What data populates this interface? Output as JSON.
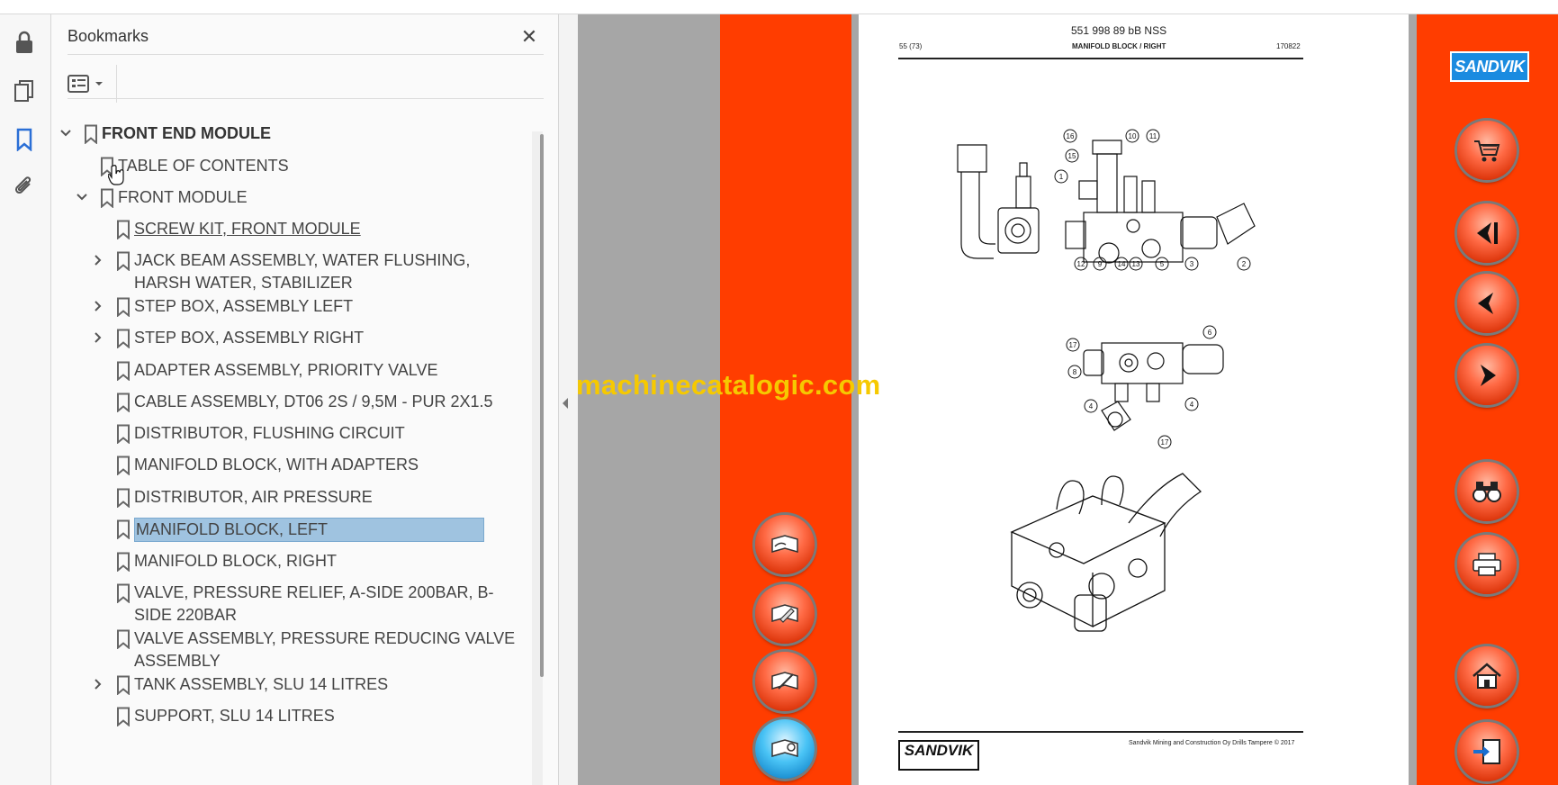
{
  "panel": {
    "title": "Bookmarks",
    "close_glyph": "✕",
    "options_icon": "bookmark-options-icon"
  },
  "left_rail": {
    "icons": [
      "lock-icon",
      "pages-icon",
      "bookmark-icon",
      "paperclip-icon"
    ]
  },
  "bookmarks": [
    {
      "label": "FRONT END MODULE",
      "level": 0,
      "expander": "expanded",
      "bold": true
    },
    {
      "label": "TABLE OF CONTENTS",
      "level": 1,
      "expander": "none"
    },
    {
      "label": "FRONT MODULE",
      "level": 1,
      "expander": "expanded"
    },
    {
      "label": "SCREW KIT, FRONT MODULE",
      "level": 2,
      "expander": "none",
      "underline": true
    },
    {
      "label": "JACK BEAM ASSEMBLY, WATER FLUSHING, HARSH WATER, STABILIZER",
      "level": 2,
      "expander": "collapsed"
    },
    {
      "label": "STEP BOX, ASSEMBLY LEFT",
      "level": 2,
      "expander": "collapsed"
    },
    {
      "label": "STEP BOX, ASSEMBLY RIGHT",
      "level": 2,
      "expander": "collapsed"
    },
    {
      "label": "ADAPTER ASSEMBLY, PRIORITY VALVE",
      "level": 2,
      "expander": "none"
    },
    {
      "label": "CABLE ASSEMBLY, DT06 2S / 9,5M - PUR 2X1.5",
      "level": 2,
      "expander": "none"
    },
    {
      "label": "DISTRIBUTOR, FLUSHING CIRCUIT",
      "level": 2,
      "expander": "none"
    },
    {
      "label": "MANIFOLD BLOCK, WITH ADAPTERS",
      "level": 2,
      "expander": "none"
    },
    {
      "label": "DISTRIBUTOR, AIR PRESSURE",
      "level": 2,
      "expander": "none"
    },
    {
      "label": "MANIFOLD BLOCK, LEFT",
      "level": 2,
      "expander": "none",
      "selected": true
    },
    {
      "label": "MANIFOLD BLOCK, RIGHT",
      "level": 2,
      "expander": "none"
    },
    {
      "label": "VALVE, PRESSURE RELIEF, A-SIDE 200BAR, B-SIDE 220BAR",
      "level": 2,
      "expander": "none"
    },
    {
      "label": "VALVE ASSEMBLY, PRESSURE REDUCING VALVE ASSEMBLY",
      "level": 2,
      "expander": "none"
    },
    {
      "label": "TANK ASSEMBLY, SLU 14 LITRES",
      "level": 2,
      "expander": "collapsed"
    },
    {
      "label": "SUPPORT, SLU 14 LITRES",
      "level": 2,
      "expander": "none"
    }
  ],
  "document": {
    "header_code": "551 998 89 bB NSS",
    "page_number": "55 (73)",
    "page_title": "MANIFOLD BLOCK / RIGHT",
    "date_code": "170822",
    "footer_company": "Sandvik Mining and Construction Oy Drills Tampere © 2017",
    "footer_logo": "SANDVIK",
    "brand_logo": "SANDVIK",
    "watermark": "machinecatalogic.com",
    "callouts": [
      "16",
      "15",
      "10",
      "11",
      "1",
      "12",
      "9",
      "14",
      "13",
      "5",
      "3",
      "2",
      "17",
      "8",
      "6",
      "4",
      "4",
      "17"
    ]
  },
  "left_nav_buttons": [
    {
      "icon": "hand-book-icon",
      "tooltip": ""
    },
    {
      "icon": "book-edit-icon",
      "tooltip": ""
    },
    {
      "icon": "book-pencil-icon",
      "tooltip": ""
    },
    {
      "icon": "book-open-icon",
      "tooltip": ""
    }
  ],
  "right_nav_buttons": [
    {
      "icon": "cart-icon"
    },
    {
      "icon": "first-page-icon"
    },
    {
      "icon": "previous-page-icon"
    },
    {
      "icon": "next-page-icon"
    },
    {
      "icon": "binoculars-icon"
    },
    {
      "icon": "printer-icon"
    },
    {
      "icon": "home-icon"
    },
    {
      "icon": "exit-icon"
    }
  ],
  "colors": {
    "accent_orange": "#ff3d00",
    "selection": "#9fc3e0",
    "active_icon": "#2a6fd6",
    "watermark": "#f6c900"
  }
}
